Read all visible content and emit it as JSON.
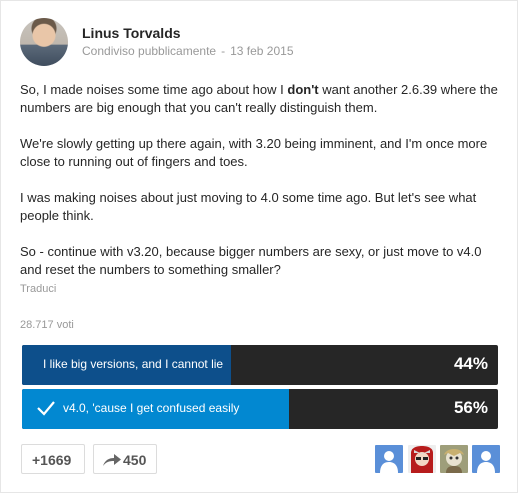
{
  "post": {
    "author": "Linus Torvalds",
    "visibility": "Condiviso pubblicamente",
    "separator": "-",
    "date": "13 feb 2015",
    "paragraphs": {
      "p1_before": "So, I made noises some time ago about how I ",
      "p1_bold": "don't",
      "p1_after": " want another 2.6.39 where the numbers are big enough that you can't really distinguish them.",
      "p2": "We're slowly getting up there again, with 3.20 being imminent, and I'm once more close to running out of fingers and toes.",
      "p3": "I was making noises about just moving to 4.0 some time ago. But let's see what people think.",
      "p4": "So - continue with v3.20, because bigger numbers are sexy, or just move to v4.0 and reset the numbers to something smaller?"
    },
    "translate_label": "Traduci"
  },
  "poll": {
    "votes_label": "28.717 voti",
    "options": [
      {
        "label": "I like big versions, and I cannot lie",
        "percent_label": "44%",
        "fraction": 0.44,
        "color": "#0d4f8b",
        "selected": false
      },
      {
        "label": "v4.0, 'cause I get confused easily",
        "percent_label": "56%",
        "fraction": 0.56,
        "color": "#0288d1",
        "selected": true
      }
    ],
    "track_color": "#262626"
  },
  "actions": {
    "plus_label": "+1669",
    "share_count": "450",
    "share_icon": "share-arrow-icon"
  },
  "voters": [
    {
      "icon": "default-avatar-icon",
      "color": "#5a8fd8"
    },
    {
      "icon": "cartoon-avatar-icon",
      "color": "#b71c1c"
    },
    {
      "icon": "cartoon-avatar-icon",
      "color": "#9e9e7a"
    },
    {
      "icon": "default-avatar-icon",
      "color": "#5a8fd8"
    }
  ]
}
